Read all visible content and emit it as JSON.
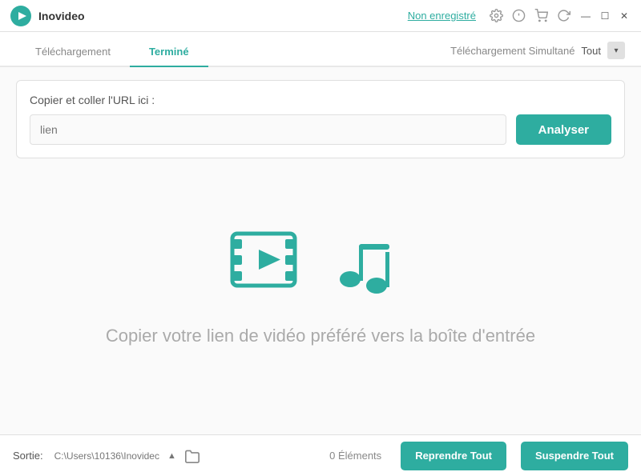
{
  "app": {
    "logo_color": "#2eada0",
    "name": "Inovideo",
    "register_link": "Non enregistré",
    "icons": [
      "settings-icon",
      "info-icon",
      "cart-icon",
      "refresh-icon"
    ]
  },
  "window_controls": {
    "minimize": "—",
    "maximize": "☐",
    "close": "✕"
  },
  "tabs": {
    "tab1": "Téléchargement",
    "tab2": "Terminé",
    "simultaneous_label": "Téléchargement Simultané",
    "tout_label": "Tout"
  },
  "url_section": {
    "label": "Copier et coller l'URL ici :",
    "placeholder": "lien",
    "analyze_button": "Analyser"
  },
  "empty_state": {
    "message": "Copier votre lien de vidéo préféré vers la boîte d'entrée"
  },
  "footer": {
    "sortie_label": "Sortie:",
    "path": "C:\\Users\\10136\\Inovidec",
    "elements_label": "0 Éléments",
    "resume_button": "Reprendre Tout",
    "suspend_button": "Suspendre Tout"
  }
}
